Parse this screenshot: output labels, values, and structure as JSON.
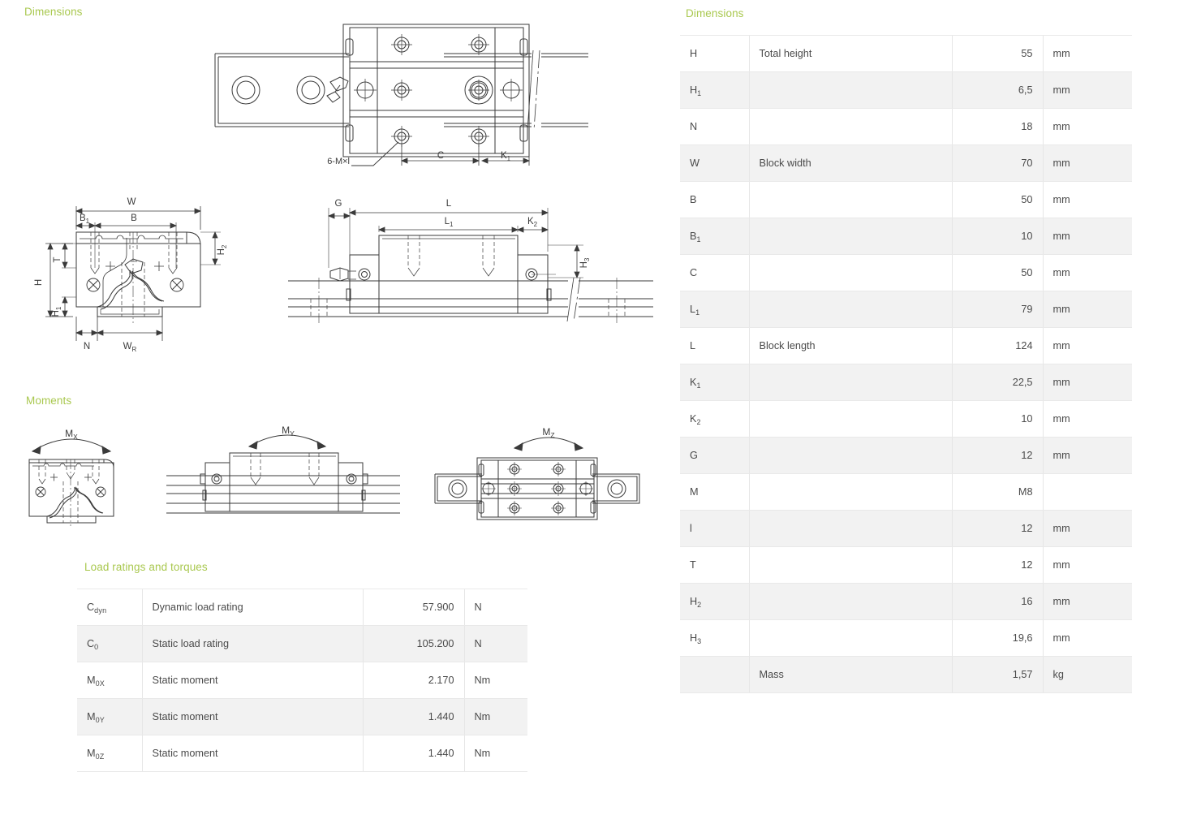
{
  "sections": {
    "dimensions_left": "Dimensions",
    "moments": "Moments",
    "load_ratings": "Load ratings and torques",
    "dimensions_right": "Dimensions"
  },
  "colors": {
    "heading": "#a9c84f",
    "row_stripe": "#f2f2f2",
    "text": "#4a4a4a",
    "drawing_line": "#3a3a3a"
  },
  "drawings": {
    "top_view": {
      "labels": [
        "6-M×l",
        "C",
        "K1"
      ]
    },
    "front_view": {
      "labels": [
        "W",
        "B1",
        "B",
        "T",
        "H",
        "H1",
        "H2",
        "N",
        "WR"
      ]
    },
    "side_view": {
      "labels": [
        "G",
        "L",
        "L1",
        "K2",
        "H3"
      ]
    },
    "moment_views": [
      {
        "label": "Mx",
        "sub": "X"
      },
      {
        "label": "My",
        "sub": "Y"
      },
      {
        "label": "Mz",
        "sub": "Z"
      }
    ]
  },
  "dimensions_table": {
    "rows": [
      {
        "symbol": "H",
        "sub": "",
        "desc": "Total height",
        "value": "55",
        "unit": "mm"
      },
      {
        "symbol": "H",
        "sub": "1",
        "desc": "",
        "value": "6,5",
        "unit": "mm"
      },
      {
        "symbol": "N",
        "sub": "",
        "desc": "",
        "value": "18",
        "unit": "mm"
      },
      {
        "symbol": "W",
        "sub": "",
        "desc": "Block width",
        "value": "70",
        "unit": "mm"
      },
      {
        "symbol": "B",
        "sub": "",
        "desc": "",
        "value": "50",
        "unit": "mm"
      },
      {
        "symbol": "B",
        "sub": "1",
        "desc": "",
        "value": "10",
        "unit": "mm"
      },
      {
        "symbol": "C",
        "sub": "",
        "desc": "",
        "value": "50",
        "unit": "mm"
      },
      {
        "symbol": "L",
        "sub": "1",
        "desc": "",
        "value": "79",
        "unit": "mm"
      },
      {
        "symbol": "L",
        "sub": "",
        "desc": "Block length",
        "value": "124",
        "unit": "mm"
      },
      {
        "symbol": "K",
        "sub": "1",
        "desc": "",
        "value": "22,5",
        "unit": "mm"
      },
      {
        "symbol": "K",
        "sub": "2",
        "desc": "",
        "value": "10",
        "unit": "mm"
      },
      {
        "symbol": "G",
        "sub": "",
        "desc": "",
        "value": "12",
        "unit": "mm"
      },
      {
        "symbol": "M",
        "sub": "",
        "desc": "",
        "value": "M8",
        "unit": ""
      },
      {
        "symbol": "l",
        "sub": "",
        "desc": "",
        "value": "12",
        "unit": "mm"
      },
      {
        "symbol": "T",
        "sub": "",
        "desc": "",
        "value": "12",
        "unit": "mm"
      },
      {
        "symbol": "H",
        "sub": "2",
        "desc": "",
        "value": "16",
        "unit": "mm"
      },
      {
        "symbol": "H",
        "sub": "3",
        "desc": "",
        "value": "19,6",
        "unit": "mm"
      },
      {
        "symbol": "",
        "sub": "",
        "desc": "Mass",
        "value": "1,57",
        "unit": "kg"
      }
    ]
  },
  "load_table": {
    "rows": [
      {
        "symbol": "C",
        "sub": "dyn",
        "desc": "Dynamic load rating",
        "value": "57.900",
        "unit": "N"
      },
      {
        "symbol": "C",
        "sub": "0",
        "desc": "Static load rating",
        "value": "105.200",
        "unit": "N"
      },
      {
        "symbol": "M",
        "sub": "0X",
        "desc": "Static moment",
        "value": "2.170",
        "unit": "Nm"
      },
      {
        "symbol": "M",
        "sub": "0Y",
        "desc": "Static moment",
        "value": "1.440",
        "unit": "Nm"
      },
      {
        "symbol": "M",
        "sub": "0Z",
        "desc": "Static moment",
        "value": "1.440",
        "unit": "Nm"
      }
    ]
  }
}
